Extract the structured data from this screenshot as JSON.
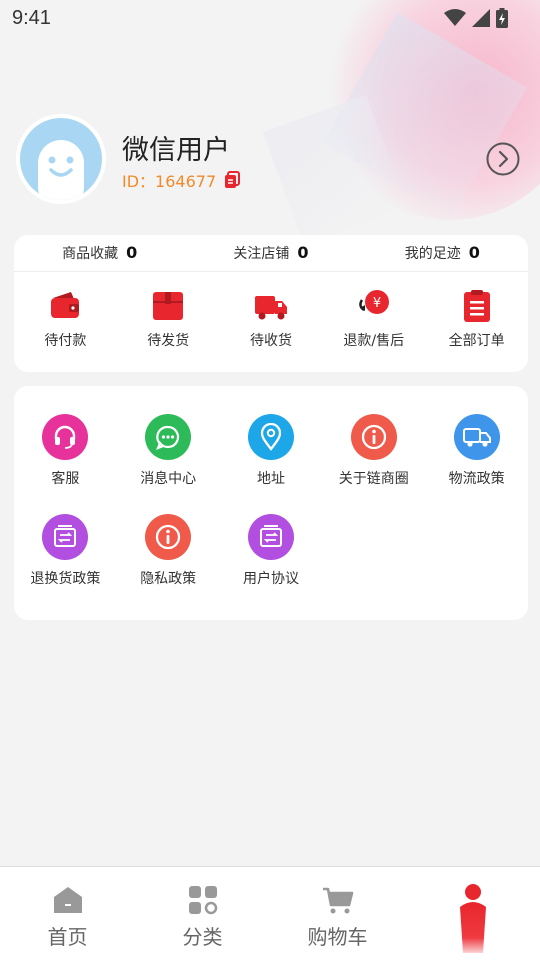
{
  "status_bar": {
    "time": "9:41"
  },
  "profile": {
    "name": "微信用户",
    "id_text": "ID：164677"
  },
  "stats": [
    {
      "label": "商品收藏",
      "count": "0"
    },
    {
      "label": "关注店铺",
      "count": "0"
    },
    {
      "label": "我的足迹",
      "count": "0"
    }
  ],
  "orders": [
    {
      "label": "待付款",
      "icon": "wallet-icon"
    },
    {
      "label": "待发货",
      "icon": "box-icon"
    },
    {
      "label": "待收货",
      "icon": "truck-icon"
    },
    {
      "label": "退款/售后",
      "icon": "refund-icon"
    },
    {
      "label": "全部订单",
      "icon": "clipboard-icon"
    }
  ],
  "services": [
    {
      "label": "客服",
      "icon": "headset-icon",
      "color": "#e7319b"
    },
    {
      "label": "消息中心",
      "icon": "message-icon",
      "color": "#2dbb5a"
    },
    {
      "label": "地址",
      "icon": "location-icon",
      "color": "#1da6e8"
    },
    {
      "label": "关于链商圈",
      "icon": "info-icon",
      "color": "#ef5a4a"
    },
    {
      "label": "物流政策",
      "icon": "truck-icon",
      "color": "#3f95ea"
    },
    {
      "label": "退换货政策",
      "icon": "exchange-icon",
      "color": "#b24fe0"
    },
    {
      "label": "隐私政策",
      "icon": "info-icon",
      "color": "#ef5a4a"
    },
    {
      "label": "用户协议",
      "icon": "exchange-icon",
      "color": "#b24fe0"
    }
  ],
  "tabbar": [
    {
      "label": "首页",
      "icon": "home-icon"
    },
    {
      "label": "分类",
      "icon": "category-icon"
    },
    {
      "label": "购物车",
      "icon": "cart-icon"
    },
    {
      "label": "",
      "icon": "profile-icon",
      "active": true
    }
  ],
  "colors": {
    "accent": "#e8262d",
    "id_orange": "#f08a2a"
  }
}
